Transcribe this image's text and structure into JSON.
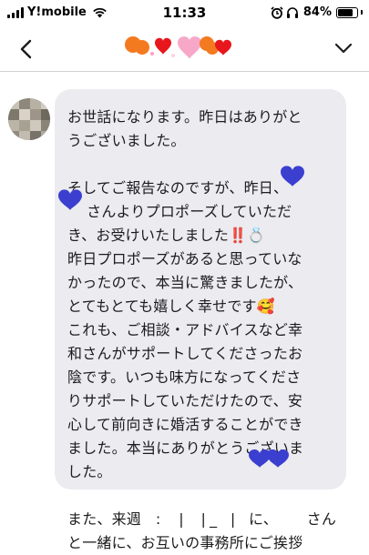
{
  "status_bar": {
    "carrier": "Y!mobile",
    "time": "11:33",
    "battery_percent": "84%",
    "battery_level": 0.84,
    "icons": [
      "signal-icon",
      "wifi-icon",
      "alarm-icon",
      "headphones-icon",
      "battery-icon"
    ]
  },
  "header": {
    "back_icon": "chevron-left-icon",
    "expand_icon": "chevron-down-icon"
  },
  "message": {
    "paragraphs": [
      "お世話になります。昨日はありがと\nうございました。",
      "そしてご報告なのですが、昨日、\n    さんよりプロポーズしていただ\nき、お受けいたしました‼️💍\n昨日プロポーズがあると思っていな\nかったので、本当に驚きましたが、\nとてもとても嬉しく幸せです🥰\nこれも、ご相談・アドバイスなど幸\n和さんがサポートしてくださったお\n陰です。いつも味方になってくださ\nりサポートしていただけたので、安\n心して前向きに婚活することができ\nました。本当にありがとうございま\nした。",
      "また、来週   :   ❘  ❘_  ❘  に、      さん\nと一緒に、お互いの事務所にご挨拶"
    ]
  },
  "colors": {
    "bubble_bg": "#ebebf0",
    "divider": "#d1d1d6",
    "censor_blue": "#3b3fd0",
    "censor_red": "#e8171d",
    "censor_orange": "#f47a20",
    "censor_pink": "#f7a8c8"
  }
}
